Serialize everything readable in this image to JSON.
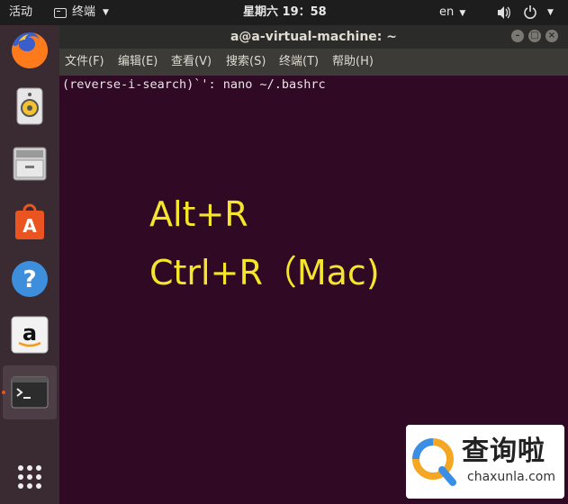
{
  "top_bar": {
    "activities": "活动",
    "app_menu": "终端",
    "clock": "星期六 19：58",
    "language": "en"
  },
  "window": {
    "title": "a@a-virtual-machine: ~",
    "menu": [
      "文件(F)",
      "编辑(E)",
      "查看(V)",
      "搜索(S)",
      "终端(T)",
      "帮助(H)"
    ]
  },
  "terminal": {
    "line": "(reverse-i-search)`': nano ~/.bashrc"
  },
  "overlay": {
    "line1": "Alt+R",
    "line2": "Ctrl+R（Mac)"
  },
  "watermark": {
    "cn": "查询啦",
    "en": "chaxunla.com"
  },
  "dock": {
    "items": [
      "firefox-icon",
      "rhythmbox-icon",
      "files-icon",
      "software-center-icon",
      "help-icon",
      "amazon-icon",
      "terminal-icon",
      "show-apps-icon"
    ]
  },
  "colors": {
    "terminal_bg": "#300a24",
    "overlay_text": "#f5e62b",
    "accent": "#e95420"
  }
}
